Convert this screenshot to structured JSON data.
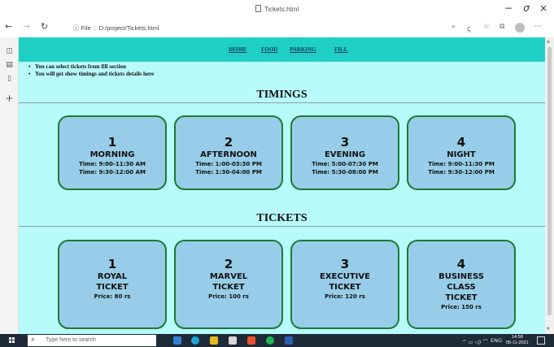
{
  "window": {
    "title": "Tickets.html"
  },
  "address_bar": {
    "file_label": "File",
    "url": "D:/project/Tickets.html"
  },
  "icons": [
    "tab-icon",
    "back-icon",
    "forward-icon",
    "refresh-icon",
    "info-icon",
    "minimize-icon",
    "maximize-icon",
    "close-icon",
    "zoom-icon",
    "read-aloud-icon",
    "favorites-icon",
    "collections-icon",
    "profile-icon",
    "more-icon",
    "tab-actions-icon",
    "vertical-tabs-icon",
    "history-icon",
    "add-icon",
    "windows-start-icon",
    "search-icon"
  ],
  "nav": {
    "items": [
      "HOME",
      "FOOD",
      "PARKING",
      "FILL"
    ]
  },
  "notes": [
    "You can select tickets from fill section",
    "You will get show timings and tickets details here"
  ],
  "timings": {
    "heading": "TIMINGS",
    "cards": [
      {
        "num": "1",
        "name": "MORNING",
        "lines": [
          "Time: 9:00-11:30 AM",
          "Time: 9:30-12:00 AM"
        ]
      },
      {
        "num": "2",
        "name": "AFTERNOON",
        "lines": [
          "Time: 1:00-03:30 PM",
          "Time: 1:30-04:00 PM"
        ]
      },
      {
        "num": "3",
        "name": "EVENING",
        "lines": [
          "Time: 5:00-07:30 PM",
          "Time: 5:30-08:00 PM"
        ]
      },
      {
        "num": "4",
        "name": "NIGHT",
        "lines": [
          "Time: 9:00-11:30 PM",
          "Time: 9:30-12:00 PM"
        ]
      }
    ]
  },
  "tickets": {
    "heading": "TICKETS",
    "cards": [
      {
        "num": "1",
        "name_lines": [
          "ROYAL",
          "TICKET"
        ],
        "price": "Price: 80 rs"
      },
      {
        "num": "2",
        "name_lines": [
          "MARVEL",
          "TICKET"
        ],
        "price": "Price: 100 rs"
      },
      {
        "num": "3",
        "name_lines": [
          "EXECUTIVE",
          "TICKET"
        ],
        "price": "Price: 120 rs"
      },
      {
        "num": "4",
        "name_lines": [
          "BUSINESS",
          "CLASS",
          "TICKET"
        ],
        "price": "Price: 150 rs"
      }
    ]
  },
  "taskbar": {
    "search_placeholder": "Type here to search",
    "tray_text": "ENG",
    "time": "14:58",
    "date": "05-11-2021"
  },
  "colors": {
    "page_bg": "#b8fbfb",
    "nav_bg": "#20cfc4",
    "card_bg": "#97cde8",
    "card_border": "#1d7a34",
    "taskbar_bg": "#1f2a38"
  }
}
